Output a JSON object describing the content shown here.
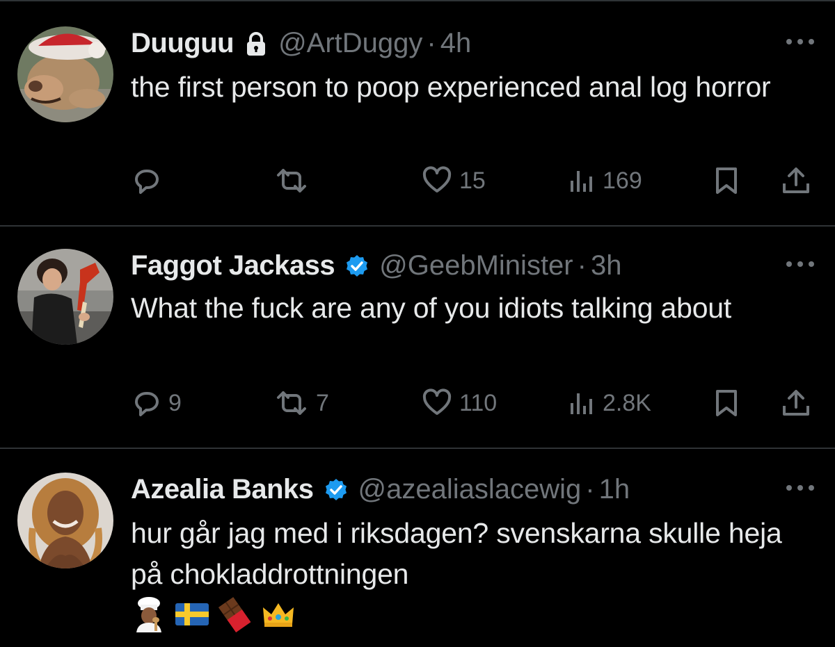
{
  "tweets": [
    {
      "display_name": "Duuguu",
      "badge": "lock-icon",
      "handle": "@ArtDuggy",
      "separator": "·",
      "time": "4h",
      "text": "the first person to poop experienced anal log horror",
      "actions": {
        "replies": "",
        "reposts": "",
        "likes": "15",
        "views": "169"
      }
    },
    {
      "display_name": "Faggot Jackass",
      "badge": "verified-badge-icon",
      "handle": "@GeebMinister",
      "separator": "·",
      "time": "3h",
      "text": "What the fuck are any of you idiots talking about",
      "actions": {
        "replies": "9",
        "reposts": "7",
        "likes": "110",
        "views": "2.8K"
      }
    },
    {
      "display_name": "Azealia Banks",
      "badge": "verified-badge-icon",
      "handle": "@azealiaslacewig",
      "separator": "·",
      "time": "1h",
      "text": "hur går jag med i riksdagen? svenskarna skulle heja på chokladdrottningen",
      "emojis": [
        "chef-emoji",
        "sweden-flag-emoji",
        "chocolate-bar-emoji",
        "crown-emoji"
      ]
    }
  ],
  "colors": {
    "background": "#000000",
    "primary_text": "#e7e9ea",
    "secondary_text": "#71767b",
    "divider": "#2f3336",
    "verified_blue": "#1d9bf0"
  }
}
